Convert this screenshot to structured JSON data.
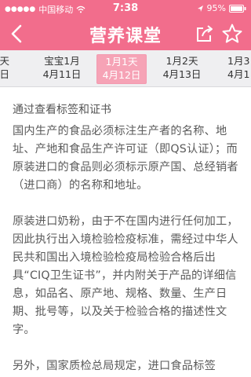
{
  "status_bar": {
    "carrier": "中国移动",
    "time": "7:38",
    "battery": "95%"
  },
  "nav": {
    "title": "营养课堂",
    "back_icon": "back-chevron-icon",
    "share_icon": "share-icon",
    "favorite_icon": "star-icon"
  },
  "date_tabs": [
    {
      "line1": "天",
      "line2": "10日",
      "active": false
    },
    {
      "line1": "宝宝1月",
      "line2": "4月11日",
      "active": false
    },
    {
      "line1": "1月1天",
      "line2": "4月12日",
      "active": true
    },
    {
      "line1": "1月2天",
      "line2": "4月13日",
      "active": false
    },
    {
      "line1": "1月3",
      "line2": "4月1",
      "active": false
    }
  ],
  "article": {
    "heading": "通过查看标签和证书",
    "paragraphs": [
      "国内生产的食品必须标注生产者的名称、地址、产地和食品生产许可证（即QS认证）；而原装进口的食品则必须标示原产国、总经销者（进口商）的名称和地址。",
      "原装进口奶粉，由于不在国内进行任何加工，因此执行出入境检验检疫标准，需经过中华人民共和国出入境检验检疫局检验合格后出具“CIQ卫生证书”，并内附关于产品的详细信息，如品名、原产地、规格、数量、生产日期、批号等，以及关于检验合格的描述性文字。",
      "另外，国家质检总局规定，进口食品标签"
    ]
  },
  "colors": {
    "brand_pink": "#f26d8c",
    "active_tab": "#f6a3b6"
  }
}
